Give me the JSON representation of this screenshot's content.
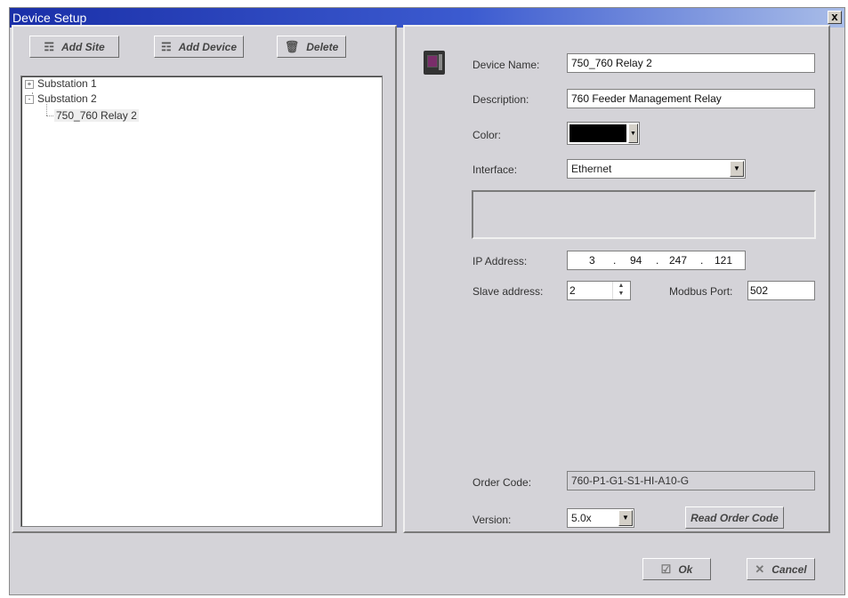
{
  "window": {
    "title": "Device Setup",
    "close_label": "x"
  },
  "toolbar": {
    "add_site": "Add Site",
    "add_device": "Add Device",
    "delete": "Delete"
  },
  "tree": {
    "nodes": [
      {
        "label": "Substation 1",
        "expander": "+"
      },
      {
        "label": "Substation 2",
        "expander": "-"
      },
      {
        "label": "750_760 Relay 2"
      }
    ]
  },
  "form": {
    "device_name_label": "Device Name:",
    "device_name_value": "750_760 Relay 2",
    "description_label": "Description:",
    "description_value": "760 Feeder Management Relay",
    "color_label": "Color:",
    "color_value": "#000000",
    "interface_label": "Interface:",
    "interface_value": "Ethernet",
    "ip_label": "IP Address:",
    "ip_octets": [
      "3",
      "94",
      "247",
      "121"
    ],
    "slave_label": "Slave address:",
    "slave_value": "2",
    "modbus_label": "Modbus Port:",
    "modbus_value": "502",
    "order_code_label": "Order Code:",
    "order_code_value": "760-P1-G1-S1-HI-A10-G",
    "version_label": "Version:",
    "version_value": "5.0x",
    "read_order_code": "Read Order Code"
  },
  "footer": {
    "ok": "Ok",
    "cancel": "Cancel"
  }
}
